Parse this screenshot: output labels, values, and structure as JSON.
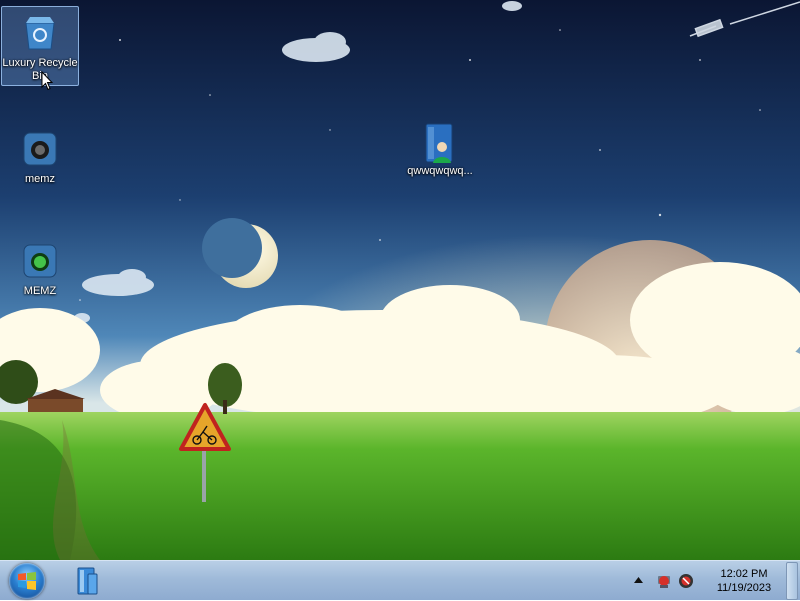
{
  "desktop": {
    "icons": [
      {
        "label": "Luxury Recycle Bin",
        "icon": "recycle-bin-icon",
        "selected": true
      },
      {
        "label": "memz",
        "icon": "program-icon"
      },
      {
        "label": "MEMZ",
        "icon": "program-icon"
      },
      {
        "label": "qwwqwqwq...",
        "icon": "user-folder-icon"
      }
    ]
  },
  "taskbar": {
    "start_icon": "windows-logo-icon",
    "pinned": [
      {
        "icon": "file-explorer-icon"
      }
    ],
    "tray": {
      "icons": [
        "show-hidden-icons-arrow",
        "network-icon",
        "volume-muted-icon"
      ]
    },
    "clock": {
      "time": "12:02 PM",
      "date": "11/19/2023"
    }
  },
  "colors": {
    "sky_top": "#0d1a38",
    "sky_mid": "#2a5c93",
    "grass": "#3f9a1e",
    "taskbar": "#a3bfdc"
  }
}
